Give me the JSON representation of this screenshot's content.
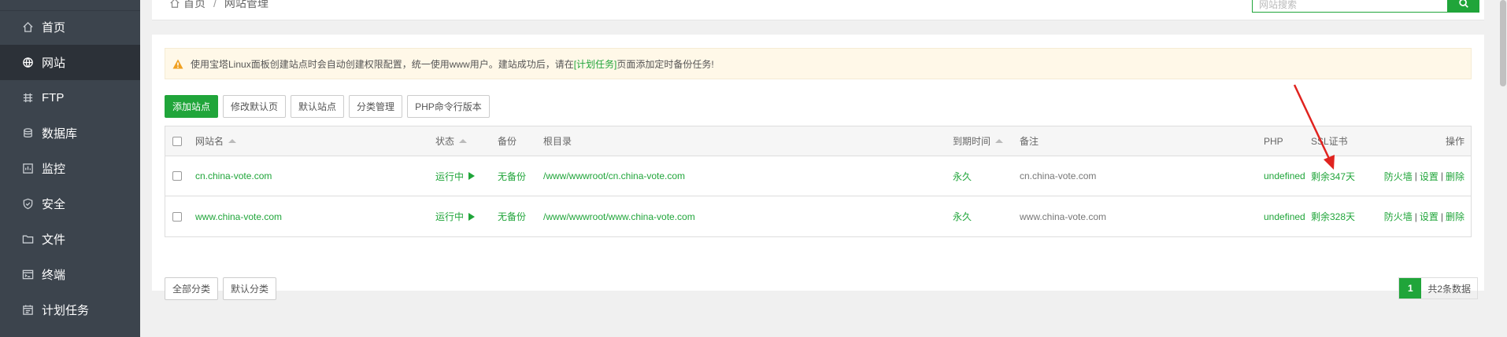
{
  "sidebar": {
    "items": [
      {
        "label": "首页",
        "icon": "home-icon"
      },
      {
        "label": "网站",
        "icon": "globe-icon",
        "active": true
      },
      {
        "label": "FTP",
        "icon": "ftp-icon"
      },
      {
        "label": "数据库",
        "icon": "database-icon"
      },
      {
        "label": "监控",
        "icon": "monitor-icon"
      },
      {
        "label": "安全",
        "icon": "shield-icon"
      },
      {
        "label": "文件",
        "icon": "folder-icon"
      },
      {
        "label": "终端",
        "icon": "terminal-icon"
      },
      {
        "label": "计划任务",
        "icon": "calendar-icon"
      }
    ]
  },
  "breadcrumb": {
    "home": "首页",
    "sep": "/",
    "current": "网站管理"
  },
  "search": {
    "placeholder": "网站搜索"
  },
  "alert": {
    "text_before": "使用宝塔Linux面板创建站点时会自动创建权限配置，统一使用www用户。建站成功后，请在",
    "link": "[计划任务]",
    "text_after": "页面添加定时备份任务!"
  },
  "toolbar": {
    "add": "添加站点",
    "edit_default": "修改默认页",
    "default_site": "默认站点",
    "category": "分类管理",
    "php_cli": "PHP命令行版本"
  },
  "table": {
    "headers": {
      "name": "网站名",
      "status": "状态",
      "backup": "备份",
      "root": "根目录",
      "expire": "到期时间",
      "note": "备注",
      "php": "PHP",
      "ssl": "SSL证书",
      "ops": "操作"
    },
    "rows": [
      {
        "name": "cn.china-vote.com",
        "status": "运行中",
        "backup": "无备份",
        "root": "/www/wwwroot/cn.china-vote.com",
        "expire": "永久",
        "note": "cn.china-vote.com",
        "php": "undefined",
        "ssl": "剩余347天",
        "op_firewall": "防火墙",
        "op_settings": "设置",
        "op_delete": "删除"
      },
      {
        "name": "www.china-vote.com",
        "status": "运行中",
        "backup": "无备份",
        "root": "/www/wwwroot/www.china-vote.com",
        "expire": "永久",
        "note": "www.china-vote.com",
        "php": "undefined",
        "ssl": "剩余328天",
        "op_firewall": "防火墙",
        "op_settings": "设置",
        "op_delete": "删除"
      }
    ]
  },
  "footer": {
    "all_categories": "全部分类",
    "default_category": "默认分类",
    "page": "1",
    "total": "共2条数据"
  },
  "colors": {
    "accent": "#20a53a",
    "sidebar": "#3c444d",
    "annotation": "#e0231f"
  }
}
